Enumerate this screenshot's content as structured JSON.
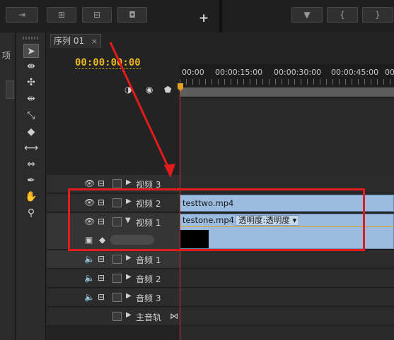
{
  "toolbar": {
    "left_buttons": [
      "⇥",
      "⊞",
      "⊟",
      "◘"
    ],
    "right_buttons": [
      "▼",
      "{",
      "}",
      "{→"
    ],
    "add_label": "+"
  },
  "project_panel": {
    "label": "项"
  },
  "tools": [
    "selection",
    "track-select",
    "ripple-edit",
    "rolling-edit",
    "rate-stretch",
    "razor",
    "slip",
    "slide",
    "pen",
    "hand",
    "zoom"
  ],
  "sequence": {
    "tab_label": "序列 01",
    "close_label": "×",
    "timecode": "00:00:00:00",
    "ruler_labels": [
      "00:00",
      "00:00:15:00",
      "00:00:30:00",
      "00:00:45:00",
      "00"
    ]
  },
  "tracks": {
    "video3": {
      "name": "视频 3"
    },
    "video2": {
      "name": "视频 2",
      "clip": "testtwo.mp4"
    },
    "video1": {
      "name": "视频 1",
      "clip": "testone.mp4",
      "effect_label": "透明度:透明度"
    },
    "audio1": {
      "name": "音频 1"
    },
    "audio2": {
      "name": "音频 2"
    },
    "audio3": {
      "name": "音频 3"
    },
    "master": {
      "name": "主音轨"
    }
  },
  "colors": {
    "timecode": "#e6b422",
    "clip": "#9bbcdf",
    "playhead": "#d23a2a",
    "annotation": "#e31b1b"
  }
}
